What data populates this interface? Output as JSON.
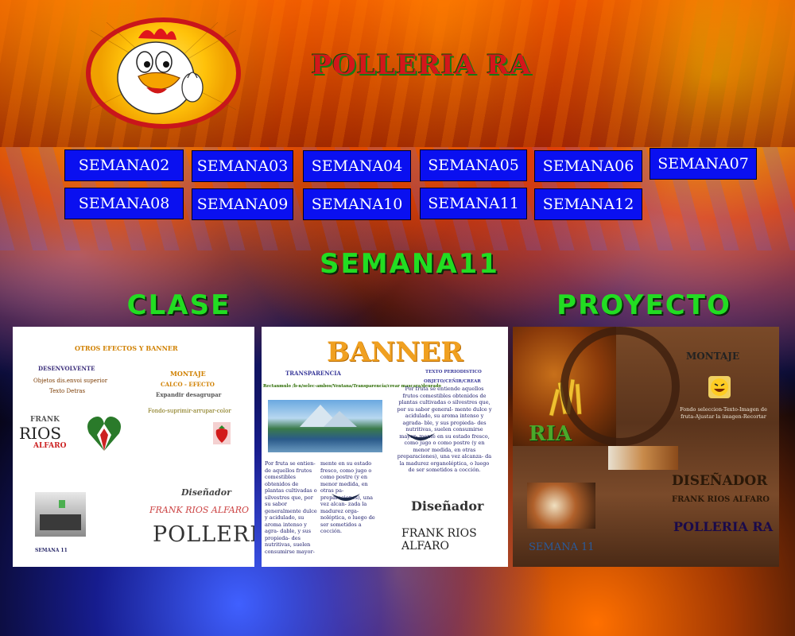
{
  "brand": {
    "title": "POLLERIA RA",
    "colors": {
      "title_fill": "#d4161b",
      "title_shadow": "#1a7a12",
      "nav_bg": "#0a10f0",
      "section_green": "#22dd22"
    }
  },
  "nav": {
    "row1": [
      "SEMANA02",
      "SEMANA03",
      "SEMANA04",
      "SEMANA05",
      "SEMANA06",
      "SEMANA07"
    ],
    "row2": [
      "SEMANA08",
      "SEMANA09",
      "SEMANA10",
      "SEMANA11",
      "SEMANA12"
    ]
  },
  "page": {
    "week_title": "SEMANA11",
    "clase_title": "CLASE",
    "proyecto_title": "PROYECTO"
  },
  "clase_doc": {
    "heading": "OTROS EFECTOS Y BANNER",
    "left_label": "DESENVOLVENTE",
    "left_line1": "Objetos dis.envoi superior",
    "left_line2": "Texto Detras",
    "montaje": "MONTAJE",
    "calco": "CALCO - EFECTO",
    "expandir": "Expandir desagrupar",
    "fondo": "Fondo-suprimir-arrupar-color",
    "logo_frank": "FRANK",
    "logo_rios": "RIOS",
    "logo_alfaro": "ALFARO",
    "disenador": "Diseñador",
    "name": "FRANK RIOS ALFARO",
    "polleria": "POLLERIA",
    "semana_label": "SEMANA 11"
  },
  "banner_doc": {
    "heading": "BANNER",
    "transparencia": "TRANSPARENCIA",
    "tools": "Rectanmulo /b-n/selec-ambos/Ventana/Transparencia/crear mascara/deurado",
    "texto_label": "TEXTO PERIODISTICO",
    "objeto_label": "OBJETO/CEÑIR/CREAR",
    "para_right": "Por fruta se entiende aquellos frutos comestibles obtenidos de plantas cultivadas o silvestres que, por su sabor general- mente dulce y acidulado, su aroma intenso y agrada- ble, y sus propieda- des nutritivas, suelen consumirse mayor- mente en su estado fresco, como jugo o como postre (y en menor medida, en otras preparaciones), una vez alcanza- da la madurez organoléptica, o luego de ser sometidos a cocción.",
    "para_left": "Por fruta se entien- de aquellos frutos comestibles obtenidos de plantas cultivadas o silvestres que, por su sabor generalmente dulce y acidulado, su aroma intenso y agra- dable, y sus propieda- des nutritivas, suelen consumirse mayor-",
    "para_mid": "mente en su estado fresco, como jugo o como postre (y en menor medida, en otras pa- preparaciones), una vez alcan- zada la madurez orga- noléptica, o luego de ser sometidos a cocción.",
    "disenador": "Diseñador",
    "name": "FRANK RIOS ALFARO"
  },
  "proyecto_doc": {
    "montaje": "MONTAJE",
    "overlay_text": "RIA",
    "small_text": "Fondo seleccion-Texto-Imagen de fruta-Ajustar la imagen-Recortar",
    "disenador": "DISEÑADOR",
    "name": "FRANK RIOS ALFARO",
    "polleria": "POLLERIA RA",
    "semana": "SEMANA 11"
  }
}
